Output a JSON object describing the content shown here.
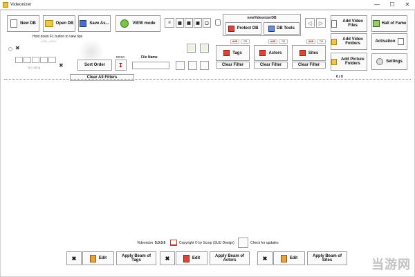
{
  "window": {
    "title": "Videonizer",
    "minimize": "—",
    "maximize": "☐",
    "close": "✕"
  },
  "toolbar": {
    "new_db": "New DB",
    "open_db": "Open DB",
    "save_as": "Save As...",
    "view_mode": "VIEW mode",
    "db_name": "newVideonizerDB",
    "protect_db": "Protect DB",
    "db_tools": "DB Tools",
    "add_video_files": "Add Video Files",
    "add_video_folders": "Add Video Folders",
    "add_picture_folders": "Add Picture Folders",
    "hall_of_fame": "Hall of Fame",
    "activation": "Activation",
    "settings": "Settings"
  },
  "hints": {
    "f1_tip": "Hold down F1 button to view tips",
    "faded_caption": "play_video",
    "rating_caption": "No rating"
  },
  "sort": {
    "sort_order": "Sort Order",
    "desc": "DESC",
    "file_name_label": "File Name",
    "clear_all_filters": "Clear All Filters"
  },
  "filters": {
    "and": "AND",
    "or": "OR",
    "tags": "Tags",
    "actors": "Actors",
    "sites": "Sites",
    "clear_filter": "Clear Filter"
  },
  "counter": "0 / 0",
  "footer": {
    "app_name": "Videonizer",
    "version": "5.0.0.0",
    "copyright": "Copyright © by Scorp (SUU Design)",
    "check_updates": "Check for updates"
  },
  "bottom": {
    "edit": "Edit",
    "apply_tags": "Apply Beam of Tags",
    "apply_actors": "Apply Beam of Actors",
    "apply_sites": "Apply Beam of Sites"
  },
  "watermark": "当游网",
  "colors": {
    "accent_red": "#cc0000",
    "border": "#9a9a9a"
  }
}
